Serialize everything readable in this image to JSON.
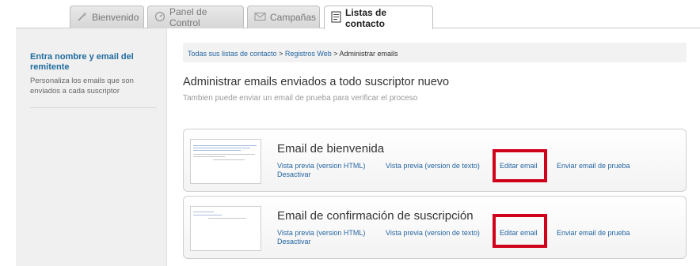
{
  "tabs": [
    {
      "label": "Bienvenido",
      "icon": "wand-icon",
      "active": false
    },
    {
      "label": "Panel de Control",
      "icon": "gauge-icon",
      "active": false
    },
    {
      "label": "Campañas",
      "icon": "envelope-icon",
      "active": false
    },
    {
      "label": "Listas de contacto",
      "icon": "list-icon",
      "active": true
    }
  ],
  "sidebar": {
    "title": "Entra nombre y email del remitente",
    "description": "Personaliza los emails que son enviados a cada suscriptor"
  },
  "breadcrumb": {
    "items": [
      "Todas sus listas de contacto",
      "Registros Web",
      "Administrar emails"
    ],
    "separator": ">"
  },
  "main": {
    "heading": "Administrar emails enviados a todo suscriptor nuevo",
    "subheading": "Tambien puede enviar un email de prueba para verificar el proceso"
  },
  "emails": [
    {
      "title": "Email de bienvenida",
      "preview_html": "Vista previa (version HTML)",
      "preview_text": "Vista previa (version de texto)",
      "edit": "Editar email",
      "send_test": "Enviar email de prueba",
      "deactivate": "Desactivar"
    },
    {
      "title": "Email de confirmación de suscripción",
      "preview_html": "Vista previa (version HTML)",
      "preview_text": "Vista previa (version de texto)",
      "edit": "Editar email",
      "send_test": "Enviar email de prueba",
      "deactivate": "Desactivar"
    }
  ],
  "colors": {
    "link": "#2565a0",
    "highlight": "#d0021b",
    "sidebar_title": "#1f6b9e"
  }
}
